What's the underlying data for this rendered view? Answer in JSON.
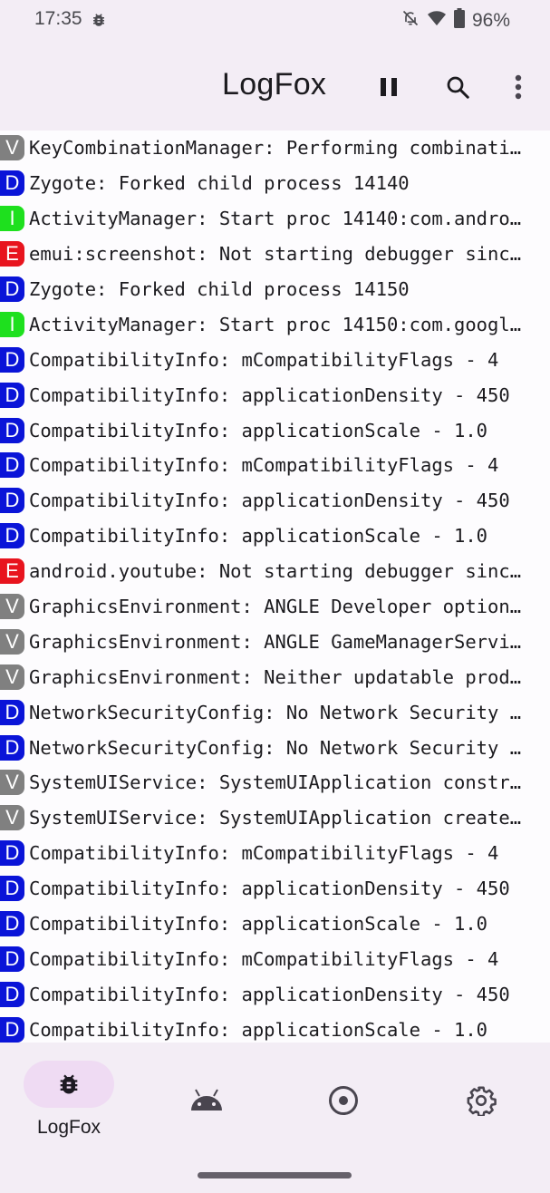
{
  "status_bar": {
    "time": "17:35",
    "battery": "96%",
    "icons": [
      "bug-icon",
      "notifications-off-icon",
      "wifi-icon",
      "battery-icon"
    ]
  },
  "app_bar": {
    "title": "LogFox",
    "actions": [
      "pause-icon",
      "search-icon",
      "more-vert-icon"
    ]
  },
  "level_colors": {
    "V": "#808080",
    "D": "#0a14d8",
    "I": "#1ee01e",
    "E": "#e8141e"
  },
  "logs": [
    {
      "level": "V",
      "text": "KeyCombinationManager: Performing combinati…"
    },
    {
      "level": "D",
      "text": "Zygote: Forked child process 14140"
    },
    {
      "level": "I",
      "text": "ActivityManager: Start proc 14140:com.andro…"
    },
    {
      "level": "E",
      "text": "emui:screenshot: Not starting debugger sinc…"
    },
    {
      "level": "D",
      "text": "Zygote: Forked child process 14150"
    },
    {
      "level": "I",
      "text": "ActivityManager: Start proc 14150:com.googl…"
    },
    {
      "level": "D",
      "text": "CompatibilityInfo: mCompatibilityFlags - 4"
    },
    {
      "level": "D",
      "text": "CompatibilityInfo: applicationDensity - 450"
    },
    {
      "level": "D",
      "text": "CompatibilityInfo: applicationScale - 1.0"
    },
    {
      "level": "D",
      "text": "CompatibilityInfo: mCompatibilityFlags - 4"
    },
    {
      "level": "D",
      "text": "CompatibilityInfo: applicationDensity - 450"
    },
    {
      "level": "D",
      "text": "CompatibilityInfo: applicationScale - 1.0"
    },
    {
      "level": "E",
      "text": "android.youtube: Not starting debugger sinc…"
    },
    {
      "level": "V",
      "text": "GraphicsEnvironment: ANGLE Developer option…"
    },
    {
      "level": "V",
      "text": "GraphicsEnvironment: ANGLE GameManagerServi…"
    },
    {
      "level": "V",
      "text": "GraphicsEnvironment: Neither updatable prod…"
    },
    {
      "level": "D",
      "text": "NetworkSecurityConfig: No Network Security …"
    },
    {
      "level": "D",
      "text": "NetworkSecurityConfig: No Network Security …"
    },
    {
      "level": "V",
      "text": "SystemUIService: SystemUIApplication constr…"
    },
    {
      "level": "V",
      "text": "SystemUIService: SystemUIApplication create…"
    },
    {
      "level": "D",
      "text": "CompatibilityInfo: mCompatibilityFlags - 4"
    },
    {
      "level": "D",
      "text": "CompatibilityInfo: applicationDensity - 450"
    },
    {
      "level": "D",
      "text": "CompatibilityInfo: applicationScale - 1.0"
    },
    {
      "level": "D",
      "text": "CompatibilityInfo: mCompatibilityFlags - 4"
    },
    {
      "level": "D",
      "text": "CompatibilityInfo: applicationDensity - 450"
    },
    {
      "level": "D",
      "text": "CompatibilityInfo: applicationScale - 1.0"
    }
  ],
  "bottom_nav": {
    "items": [
      {
        "icon": "bug-icon",
        "label": "LogFox",
        "selected": true
      },
      {
        "icon": "android-icon",
        "label": "",
        "selected": false
      },
      {
        "icon": "record-icon",
        "label": "",
        "selected": false
      },
      {
        "icon": "settings-icon",
        "label": "",
        "selected": false
      }
    ]
  }
}
